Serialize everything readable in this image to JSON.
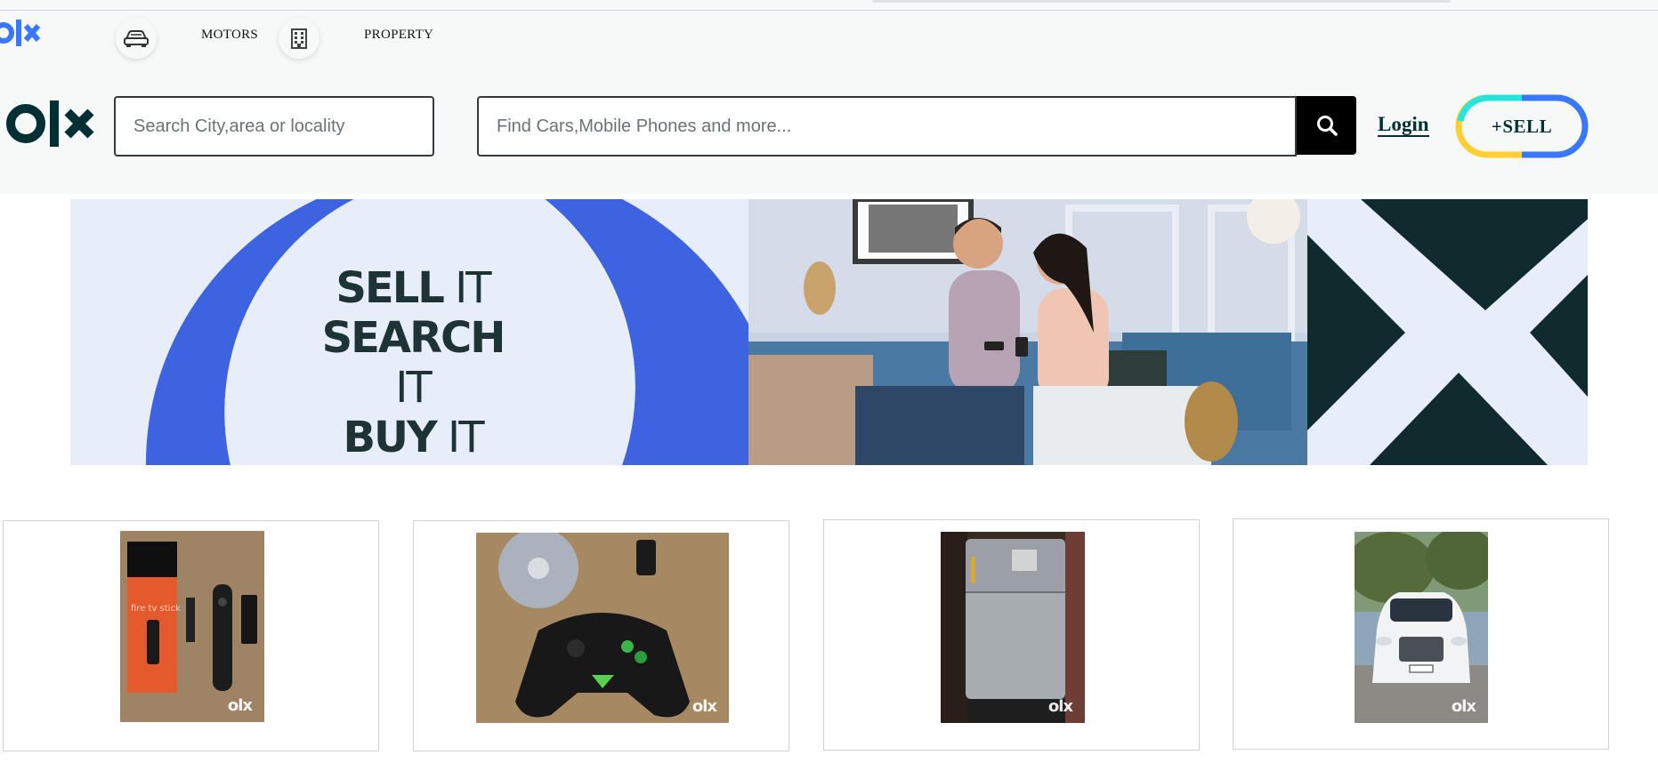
{
  "brand": {
    "logo_text": "olx",
    "accent_blue": "#3a77ff",
    "dark_teal": "#002f34"
  },
  "categories": [
    {
      "label": "MOTORS",
      "icon": "car-icon"
    },
    {
      "label": "PROPERTY",
      "icon": "building-icon"
    }
  ],
  "header": {
    "location_placeholder": "Search City,area or locality",
    "search_placeholder": "Find Cars,Mobile Phones and more...",
    "search_icon": "search-icon",
    "login_label": "Login",
    "sell_label": "+SELL"
  },
  "banner": {
    "line1_bold": "SELL",
    "line1_light": " IT",
    "line2_bold": "SEARCH",
    "line2_light": " IT",
    "line3_bold": "BUY",
    "line3_light": " IT",
    "colors": {
      "ring": "#3d63e0",
      "bg": "#e8eef9",
      "x_dark": "#0f2b2d"
    }
  },
  "products": [
    {
      "name": "fire tv stick",
      "thumb_text": "fire tv stick",
      "watermark": "olx"
    },
    {
      "name": "game controller",
      "watermark": "olx"
    },
    {
      "name": "refrigerator",
      "watermark": "olx"
    },
    {
      "name": "white car",
      "watermark": "olx"
    }
  ]
}
